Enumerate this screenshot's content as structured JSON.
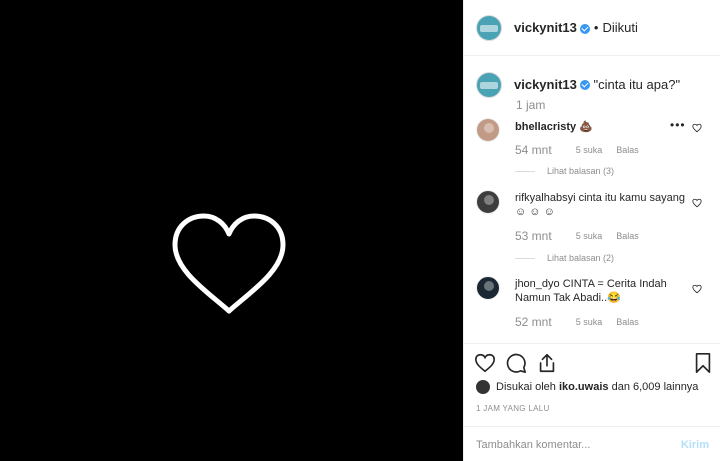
{
  "post": {
    "author": "vickynit13",
    "follow_status": "Diikuti",
    "dot": "•",
    "caption": "\"cinta itu apa?\"",
    "caption_age": "1 jam"
  },
  "comments": [
    {
      "username": "bhellacristy",
      "text": "💩",
      "age": "54 mnt",
      "likes": "5 suka",
      "reply": "Balas",
      "view_replies": "Lihat balasan (3)",
      "more": "•••"
    },
    {
      "username": "rifkyalhabsyi",
      "text": "cinta itu kamu sayang ☺ ☺ ☺",
      "age": "53 mnt",
      "likes": "5 suka",
      "reply": "Balas",
      "view_replies": "Lihat balasan (2)"
    },
    {
      "username": "jhon_dyo",
      "text": "CINTA = Cerita Indah Namun Tak Abadi..😂",
      "age": "52 mnt",
      "likes": "5 suka",
      "reply": "Balas"
    }
  ],
  "actions": {
    "liked_prefix": "Disukai oleh",
    "liked_user": "iko.uwais",
    "liked_suffix": "dan 6,009 lainnya",
    "timestamp": "1 JAM YANG LALU",
    "comment_placeholder": "Tambahkan komentar...",
    "post_label": "Kirim"
  },
  "icons": {
    "media": "heart-outline-icon",
    "like": "heart-icon",
    "comment": "comment-icon",
    "share": "share-icon",
    "save": "bookmark-icon",
    "verified": "verified-badge-icon"
  },
  "colors": {
    "verified": "#3897f0",
    "post_button": "#b2dffc",
    "muted_text": "#8e8e8e"
  }
}
